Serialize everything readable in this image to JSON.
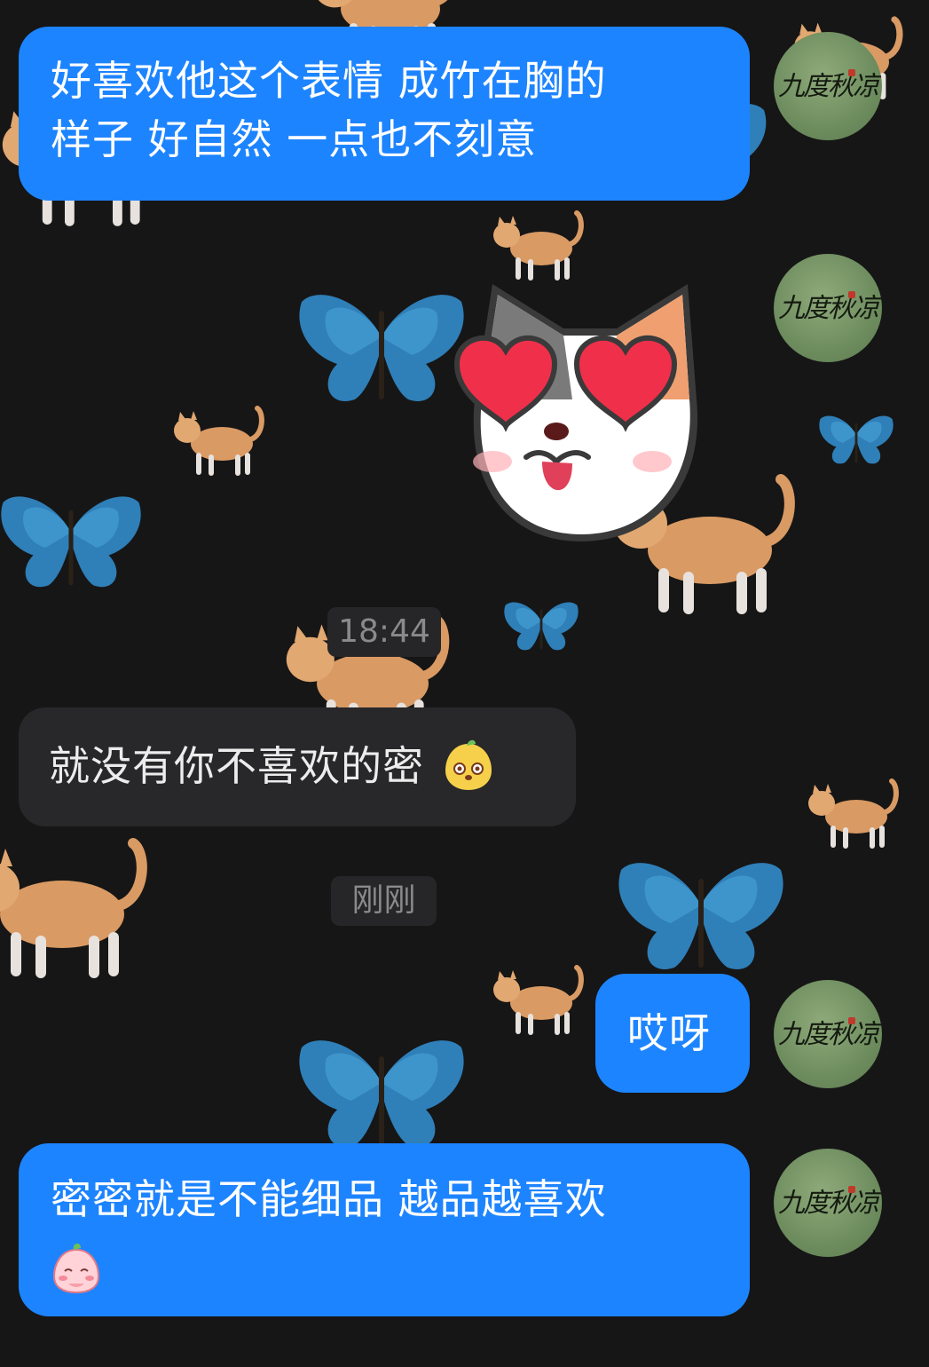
{
  "colors": {
    "background": "#161616",
    "outgoing_bubble": "#1d84ff",
    "incoming_bubble": "#28282a",
    "timestamp_pill": "#262628"
  },
  "avatar": {
    "text": "九度秋凉"
  },
  "messages": [
    {
      "side": "out",
      "line1": "好喜欢他这个表情 成竹在胸的",
      "line2": "样子 好自然 一点也不刻意"
    },
    {
      "side": "out",
      "type": "sticker",
      "sticker": "heart-eyes-cat-sticker"
    },
    {
      "type": "time",
      "text": "18:44"
    },
    {
      "side": "in",
      "text": "就没有你不喜欢的密",
      "emoji": "chick-emoji"
    },
    {
      "type": "time",
      "text": "刚刚"
    },
    {
      "side": "out",
      "text": "哎呀"
    },
    {
      "side": "out",
      "text": "密密就是不能细品 越品越喜欢",
      "emoji": "shy-peach-emoji"
    }
  ]
}
